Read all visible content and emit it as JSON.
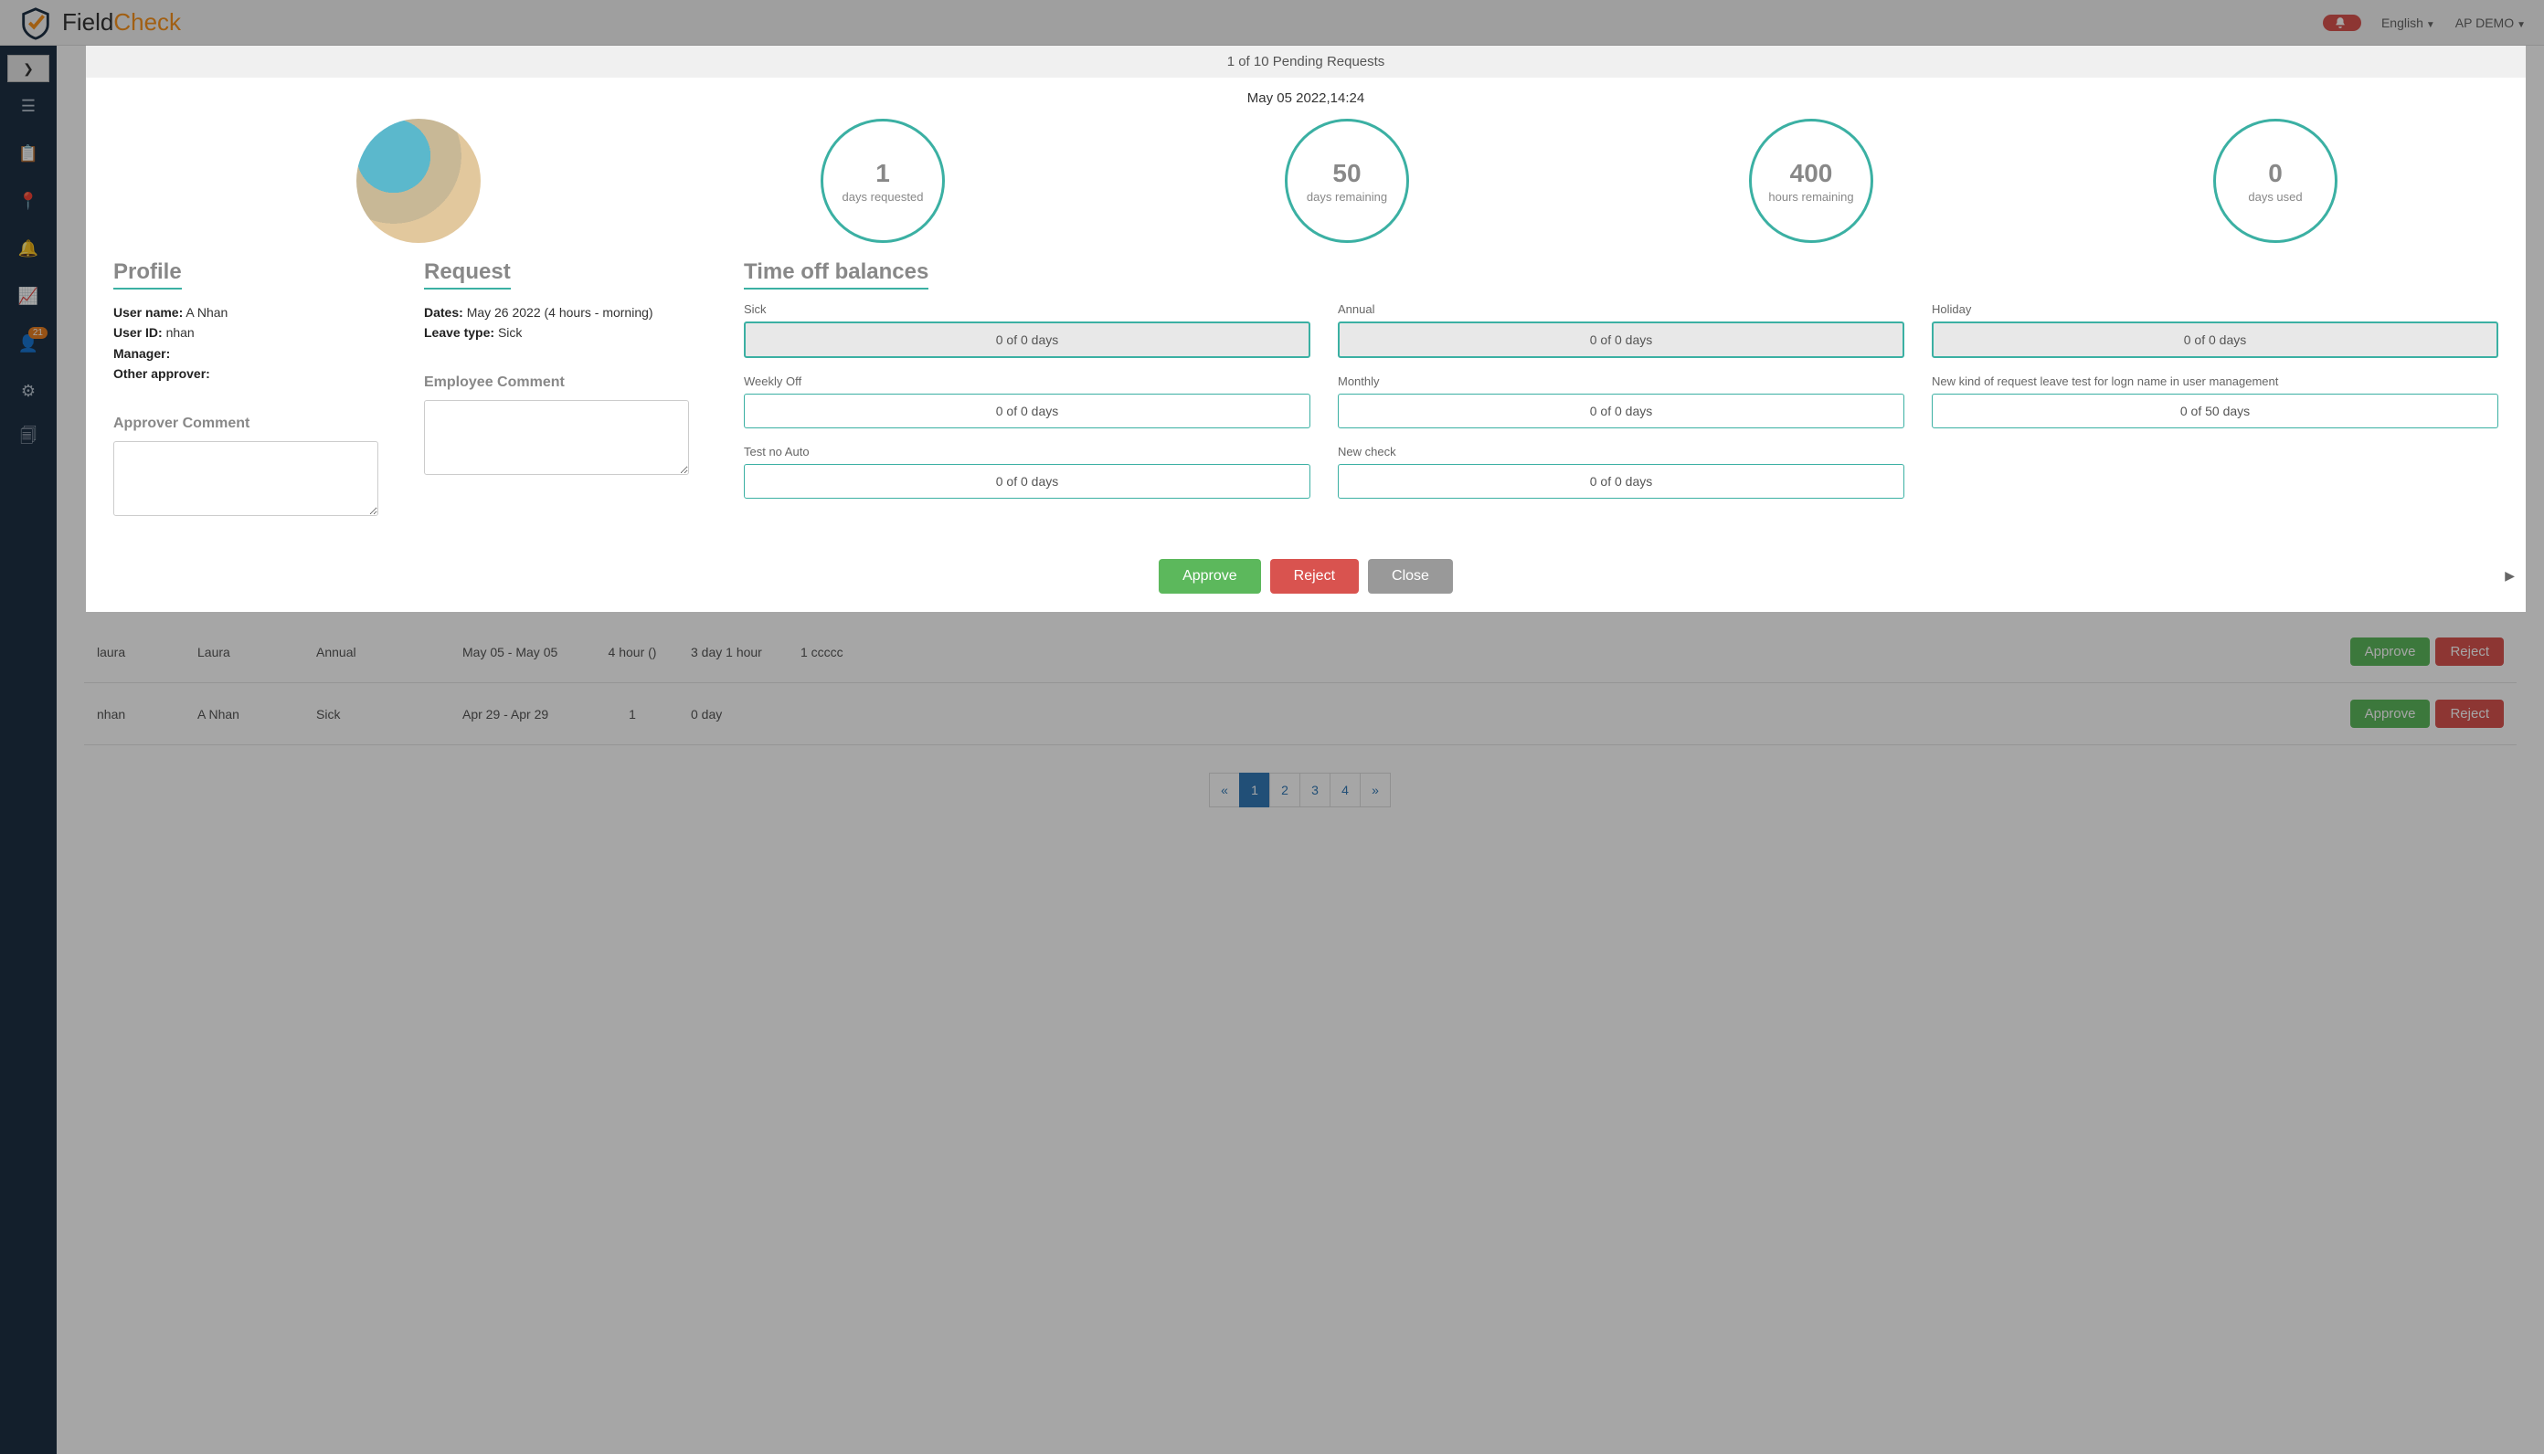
{
  "header": {
    "brand_field": "Field",
    "brand_check": "Check",
    "bell_count": "",
    "lang": "English",
    "user": "AP DEMO"
  },
  "sidebar": {
    "badge_users": "21"
  },
  "modal": {
    "banner": "1 of 10 Pending Requests",
    "timestamp": "May 05 2022,14:24",
    "circles": [
      {
        "num": "1",
        "lbl": "days requested"
      },
      {
        "num": "50",
        "lbl": "days remaining"
      },
      {
        "num": "400",
        "lbl": "hours remaining"
      },
      {
        "num": "0",
        "lbl": "days used"
      }
    ],
    "profile_heading": "Profile",
    "request_heading": "Request",
    "balances_heading": "Time off balances",
    "profile": {
      "user_name_k": "User name:",
      "user_name_v": "A Nhan",
      "user_id_k": "User ID:",
      "user_id_v": "nhan",
      "manager_k": "Manager:",
      "manager_v": "",
      "other_approver_k": "Other approver:",
      "other_approver_v": ""
    },
    "request": {
      "dates_k": "Dates:",
      "dates_v": "May 26 2022 (4 hours - morning)",
      "leave_type_k": "Leave type:",
      "leave_type_v": "Sick"
    },
    "approver_comment_lbl": "Approver Comment",
    "employee_comment_lbl": "Employee Comment",
    "balances": [
      {
        "label": "Sick",
        "value": "0 of 0 days",
        "disabled": true
      },
      {
        "label": "Annual",
        "value": "0 of 0 days",
        "disabled": true
      },
      {
        "label": "Holiday",
        "value": "0 of 0 days",
        "disabled": true
      },
      {
        "label": "Weekly Off",
        "value": "0 of 0 days",
        "disabled": false
      },
      {
        "label": "Monthly",
        "value": "0 of 0 days",
        "disabled": false
      },
      {
        "label": "New kind of request leave test for logn name in user management",
        "value": "0 of 50 days",
        "disabled": false
      },
      {
        "label": "Test no Auto",
        "value": "0 of 0 days",
        "disabled": false
      },
      {
        "label": "New check",
        "value": "0 of 0 days",
        "disabled": false
      }
    ],
    "actions": {
      "approve": "Approve",
      "reject": "Reject",
      "close": "Close"
    }
  },
  "table": {
    "rows": [
      {
        "id": "laura",
        "name": "Laura",
        "type": "Annual",
        "dates": "May 05 - May 05",
        "req": "4 hour ()",
        "bal": "3 day 1 hour",
        "note": "1 ccccc"
      },
      {
        "id": "nhan",
        "name": "A Nhan",
        "type": "Sick",
        "dates": "Apr 29 - Apr 29",
        "req": "1",
        "bal": "0 day",
        "note": ""
      }
    ],
    "approve": "Approve",
    "reject": "Reject",
    "pages": [
      "«",
      "1",
      "2",
      "3",
      "4",
      "»"
    ]
  }
}
